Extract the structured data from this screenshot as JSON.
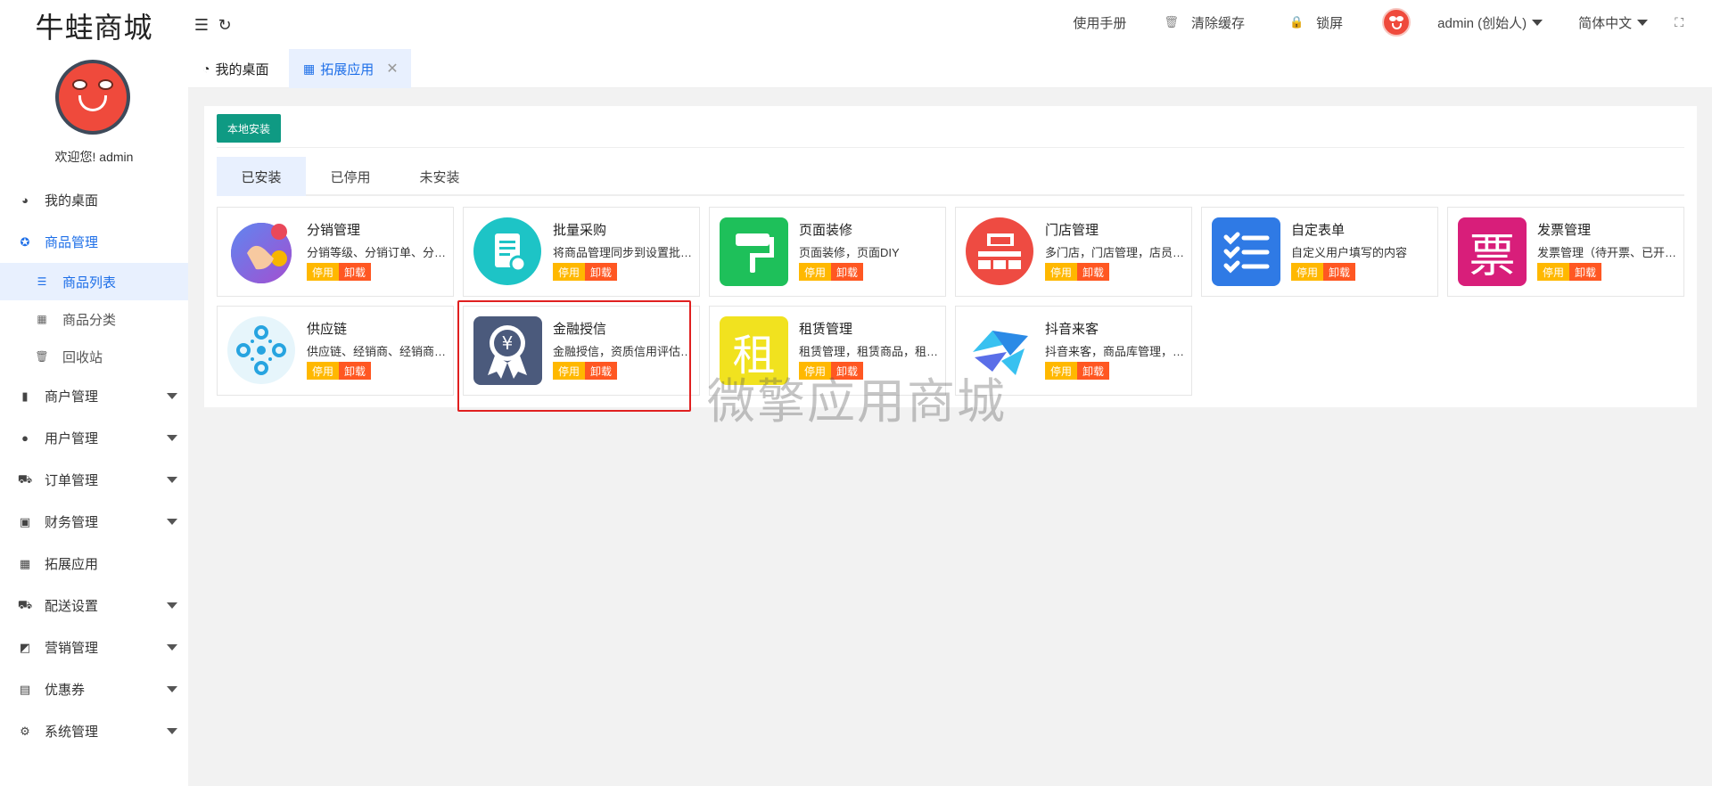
{
  "brand": {
    "logo": "牛蛙商城",
    "welcome": "欢迎您! admin"
  },
  "sidebar": {
    "items": [
      {
        "label": "我的桌面",
        "icon": "dashboard-icon"
      },
      {
        "label": "商品管理",
        "icon": "product-icon",
        "active": true
      },
      {
        "label": "商品列表",
        "icon": "list-icon",
        "sub": true,
        "active": true
      },
      {
        "label": "商品分类",
        "icon": "grid-icon",
        "sub": true
      },
      {
        "label": "回收站",
        "icon": "trash-icon",
        "sub": true
      },
      {
        "label": "商户管理",
        "icon": "merchant-icon",
        "expandable": true
      },
      {
        "label": "用户管理",
        "icon": "user-icon",
        "expandable": true
      },
      {
        "label": "订单管理",
        "icon": "cart-icon",
        "expandable": true
      },
      {
        "label": "财务管理",
        "icon": "money-icon",
        "expandable": true
      },
      {
        "label": "拓展应用",
        "icon": "apps-icon"
      },
      {
        "label": "配送设置",
        "icon": "truck-icon",
        "expandable": true
      },
      {
        "label": "营销管理",
        "icon": "marketing-icon",
        "expandable": true
      },
      {
        "label": "优惠券",
        "icon": "coupon-icon",
        "expandable": true
      },
      {
        "label": "系统管理",
        "icon": "gear-icon",
        "expandable": true
      }
    ]
  },
  "header": {
    "manual": "使用手册",
    "clear_cache": "清除缓存",
    "lock": "锁屏",
    "user": "admin (创始人)",
    "language": "简体中文"
  },
  "tabs": {
    "home": "我的桌面",
    "active": "拓展应用"
  },
  "content": {
    "install_button": "本地安装",
    "subtabs": [
      "已安装",
      "已停用",
      "未安装"
    ],
    "stop_label": "停用",
    "uninstall_label": "卸载",
    "apps": [
      {
        "name": "分销管理",
        "desc": "分销等级、分销订单、分销员管理"
      },
      {
        "name": "批量采购",
        "desc": "将商品管理同步到设置批量采购"
      },
      {
        "name": "页面装修",
        "desc": "页面装修，页面DIY"
      },
      {
        "name": "门店管理",
        "desc": "多门店，门店管理，店员管理"
      },
      {
        "name": "自定表单",
        "desc": "自定义用户填写的内容"
      },
      {
        "name": "发票管理",
        "desc": "发票管理（待开票、已开票）"
      },
      {
        "name": "供应链",
        "desc": "供应链、经销商、经销商管理"
      },
      {
        "name": "金融授信",
        "desc": "金融授信，资质信用评估管理"
      },
      {
        "name": "租赁管理",
        "desc": "租赁管理，租赁商品，租赁订单"
      },
      {
        "name": "抖音来客",
        "desc": "抖音来客，商品库管理，核销"
      }
    ],
    "icon_glyphs": {
      "invoice": "票",
      "rent": "租",
      "yuan": "¥"
    },
    "watermark": "微擎应用商城"
  },
  "colors": {
    "accent": "#1e6fe8",
    "install": "#0f9a83",
    "stop": "#ffb800",
    "uninstall": "#ff5722",
    "highlight": "#e02020"
  }
}
